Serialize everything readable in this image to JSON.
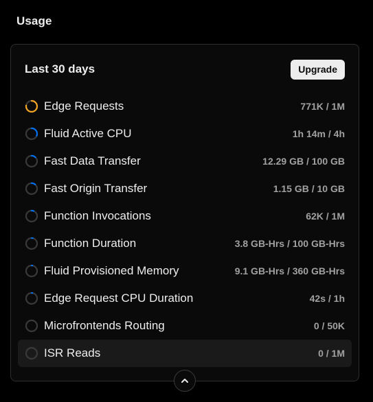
{
  "header": {
    "title": "Usage"
  },
  "card": {
    "title": "Last 30 days",
    "upgrade_label": "Upgrade",
    "collapse_icon": "chevron-up-icon",
    "items": [
      {
        "label": "Edge Requests",
        "value": "771K / 1M",
        "fraction": 0.771,
        "color": "#f5a623"
      },
      {
        "label": "Fluid Active CPU",
        "value": "1h 14m / 4h",
        "fraction": 0.31,
        "color": "#0070f3"
      },
      {
        "label": "Fast Data Transfer",
        "value": "12.29 GB / 100 GB",
        "fraction": 0.123,
        "color": "#0070f3"
      },
      {
        "label": "Fast Origin Transfer",
        "value": "1.15 GB / 10 GB",
        "fraction": 0.115,
        "color": "#0070f3"
      },
      {
        "label": "Function Invocations",
        "value": "62K / 1M",
        "fraction": 0.062,
        "color": "#0070f3"
      },
      {
        "label": "Function Duration",
        "value": "3.8 GB-Hrs / 100 GB-Hrs",
        "fraction": 0.038,
        "color": "#0070f3"
      },
      {
        "label": "Fluid Provisioned Memory",
        "value": "9.1 GB-Hrs / 360 GB-Hrs",
        "fraction": 0.025,
        "color": "#0070f3"
      },
      {
        "label": "Edge Request CPU Duration",
        "value": "42s / 1h",
        "fraction": 0.012,
        "color": "#0070f3"
      },
      {
        "label": "Microfrontends Routing",
        "value": "0 / 50K",
        "fraction": 0,
        "color": "#0070f3"
      },
      {
        "label": "ISR Reads",
        "value": "0 / 1M",
        "fraction": 0,
        "color": "#0070f3"
      }
    ]
  },
  "colors": {
    "ring_track": "#3a3a3a",
    "background": "#000000",
    "card": "#0a0a0a"
  }
}
